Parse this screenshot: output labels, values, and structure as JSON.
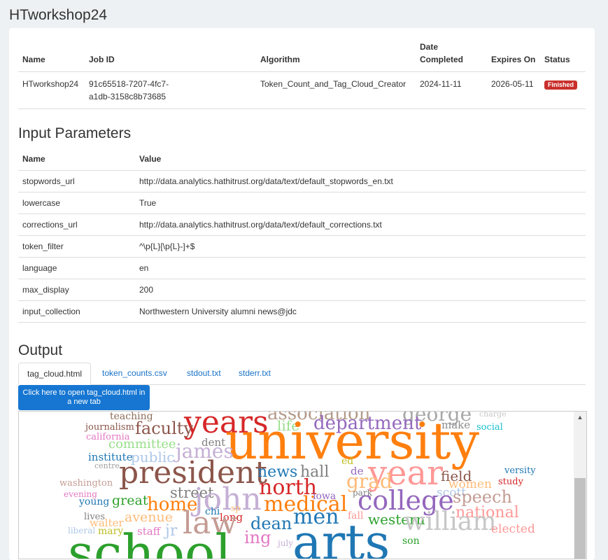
{
  "page": {
    "title": "HTworkshop24"
  },
  "jobs_table": {
    "headers": {
      "name": "Name",
      "job_id": "Job ID",
      "algorithm": "Algorithm",
      "date_completed": "Date Completed",
      "expires_on": "Expires On",
      "status": "Status"
    },
    "row": {
      "name": "HTworkshop24",
      "job_id_line1": "91c65518-7207-4fc7-",
      "job_id_line2": "a1db-3158c8b73685",
      "algorithm": "Token_Count_and_Tag_Cloud_Creator",
      "date_completed": "2024-11-11",
      "expires_on": "2026-05-11",
      "status": "Finished"
    }
  },
  "input_parameters": {
    "title": "Input Parameters",
    "headers": {
      "name": "Name",
      "value": "Value"
    },
    "rows": [
      {
        "name": "stopwords_url",
        "value": "http://data.analytics.hathitrust.org/data/text/default_stopwords_en.txt"
      },
      {
        "name": "lowercase",
        "value": "True"
      },
      {
        "name": "corrections_url",
        "value": "http://data.analytics.hathitrust.org/data/text/default_corrections.txt"
      },
      {
        "name": "token_filter",
        "value": "^\\p{L}[\\p{L}-]+$"
      },
      {
        "name": "language",
        "value": "en"
      },
      {
        "name": "max_display",
        "value": "200"
      },
      {
        "name": "input_collection",
        "value": "Northwestern University alumni news@jdc"
      }
    ]
  },
  "output": {
    "title": "Output",
    "tabs": [
      {
        "label": "tag_cloud.html",
        "active": true
      },
      {
        "label": "token_counts.csv",
        "active": false
      },
      {
        "label": "stdout.txt",
        "active": false
      },
      {
        "label": "stderr.txt",
        "active": false
      }
    ],
    "open_button_label": "Click here to open tag_cloud.html in a new tab",
    "tag_cloud": [
      {
        "text": "association",
        "color": "#b39b8a"
      },
      {
        "text": "george",
        "color": "#a8a8a8"
      },
      {
        "text": "charge",
        "color": "#c7c7c7"
      },
      {
        "text": "teaching",
        "color": "#8c6d5a"
      },
      {
        "text": "years",
        "color": "#d62728"
      },
      {
        "text": "life",
        "color": "#98df8a"
      },
      {
        "text": "department",
        "color": "#9467bd"
      },
      {
        "text": "make",
        "color": "#8c8c8c"
      },
      {
        "text": "journalism",
        "color": "#8c564b"
      },
      {
        "text": "faculty",
        "color": "#8c564b"
      },
      {
        "text": "social",
        "color": "#17becf"
      },
      {
        "text": "california",
        "color": "#e377c2"
      },
      {
        "text": "university",
        "color": "#ff7f0e"
      },
      {
        "text": "committee",
        "color": "#98df8a"
      },
      {
        "text": "dent",
        "color": "#7f7f7f"
      },
      {
        "text": "james",
        "color": "#c5b0d5"
      },
      {
        "text": "institute",
        "color": "#1f77b4"
      },
      {
        "text": "public",
        "color": "#aec7e8"
      },
      {
        "text": "ed",
        "color": "#bcbd22"
      },
      {
        "text": "centre",
        "color": "#a0a0a0"
      },
      {
        "text": "de",
        "color": "#9467bd"
      },
      {
        "text": "versity",
        "color": "#1f77b4"
      },
      {
        "text": "president",
        "color": "#8c564b"
      },
      {
        "text": "news",
        "color": "#1f77b4"
      },
      {
        "text": "hall",
        "color": "#7f7f7f"
      },
      {
        "text": "year",
        "color": "#ff9896"
      },
      {
        "text": "field",
        "color": "#8c564b"
      },
      {
        "text": "washington",
        "color": "#c49c94"
      },
      {
        "text": "grad",
        "color": "#ffbb78"
      },
      {
        "text": "women",
        "color": "#ffbb78"
      },
      {
        "text": "study",
        "color": "#d62728"
      },
      {
        "text": "north",
        "color": "#d62728"
      },
      {
        "text": "evening",
        "color": "#e377c2"
      },
      {
        "text": "street",
        "color": "#7f7f7f"
      },
      {
        "text": "park",
        "color": "#7f7f7f"
      },
      {
        "text": "scott",
        "color": "#aec7e8"
      },
      {
        "text": "college",
        "color": "#9467bd"
      },
      {
        "text": "speech",
        "color": "#c49c94"
      },
      {
        "text": "young",
        "color": "#1f77b4"
      },
      {
        "text": "great",
        "color": "#2ca02c"
      },
      {
        "text": "home",
        "color": "#ff7f0e"
      },
      {
        "text": "john",
        "color": "#c5b0d5"
      },
      {
        "text": "iowa",
        "color": "#9467bd"
      },
      {
        "text": "medical",
        "color": "#ff7f0e"
      },
      {
        "text": "national",
        "color": "#ff9896"
      },
      {
        "text": "chi",
        "color": "#1f77b4"
      },
      {
        "text": "sp",
        "color": "#ffbb78"
      },
      {
        "text": "lives",
        "color": "#7f7f7f"
      },
      {
        "text": "avenue",
        "color": "#ffbb78"
      },
      {
        "text": "long",
        "color": "#d62728"
      },
      {
        "text": "men",
        "color": "#1f77b4"
      },
      {
        "text": "fall",
        "color": "#ff9896"
      },
      {
        "text": "western",
        "color": "#2ca02c"
      },
      {
        "text": "william",
        "color": "#c7c7c7"
      },
      {
        "text": "walter",
        "color": "#ffbb78"
      },
      {
        "text": "law",
        "color": "#c49c94"
      },
      {
        "text": "dean",
        "color": "#1f77b4"
      },
      {
        "text": "elected",
        "color": "#ff9896"
      },
      {
        "text": "liberal",
        "color": "#aec7e8"
      },
      {
        "text": "mary",
        "color": "#bcbd22"
      },
      {
        "text": "staff",
        "color": "#e377c2"
      },
      {
        "text": "jr",
        "color": "#aec7e8"
      },
      {
        "text": "ing",
        "color": "#e377c2"
      },
      {
        "text": "school",
        "color": "#2ca02c"
      },
      {
        "text": "arts",
        "color": "#1f77b4"
      },
      {
        "text": "july",
        "color": "#c5b0d5"
      },
      {
        "text": "son",
        "color": "#2ca02c"
      }
    ]
  }
}
